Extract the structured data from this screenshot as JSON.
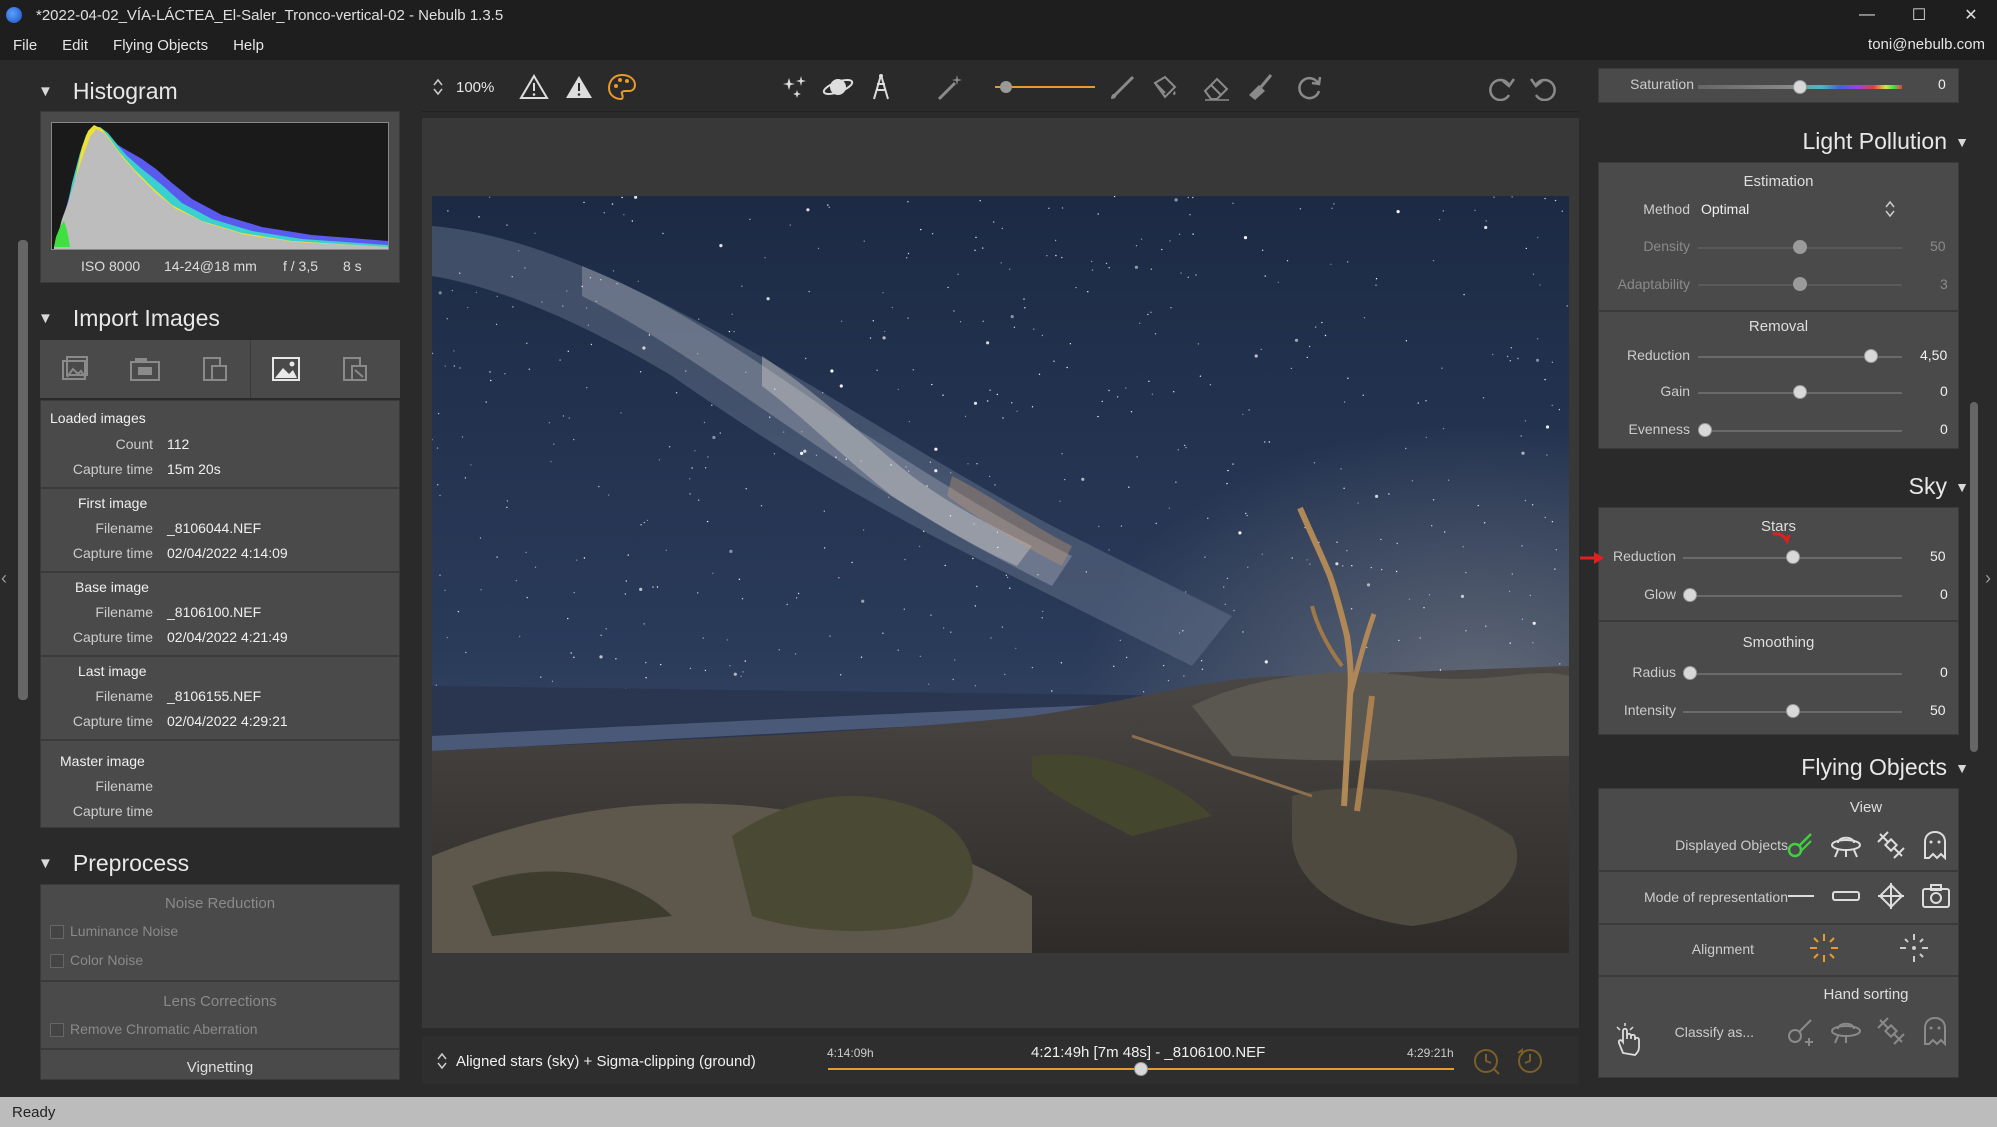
{
  "window": {
    "title": "*2022-04-02_VÍA-LÁCTEA_El-Saler_Tronco-vertical-02 - Nebulb 1.3.5",
    "minimize": "—",
    "maximize": "☐",
    "close": "✕"
  },
  "menu": {
    "items": [
      "File",
      "Edit",
      "Flying Objects",
      "Help"
    ],
    "user": "toni@nebulb.com"
  },
  "status": "Ready",
  "histogram": {
    "title": "Histogram",
    "iso": "ISO 8000",
    "lens": "14-24@18 mm",
    "aperture": "f / 3,5",
    "exposure": "8 s"
  },
  "import": {
    "title": "Import Images",
    "loaded_title": "Loaded images",
    "count_label": "Count",
    "count": "112",
    "capture_label": "Capture time",
    "capture_time": "15m 20s",
    "first_title": "First image",
    "filename_label": "Filename",
    "first_filename": "_8106044.NEF",
    "first_time": "02/04/2022 4:14:09",
    "base_title": "Base image",
    "base_filename": "_8106100.NEF",
    "base_time": "02/04/2022 4:21:49",
    "last_title": "Last image",
    "last_filename": "_8106155.NEF",
    "last_time": "02/04/2022 4:29:21",
    "master_title": "Master image"
  },
  "preprocess": {
    "title": "Preprocess",
    "noise_title": "Noise Reduction",
    "luminance": "Luminance Noise",
    "color": "Color Noise",
    "lens_title": "Lens Corrections",
    "chromatic": "Remove Chromatic Aberration",
    "vignetting": "Vignetting"
  },
  "toolbar": {
    "zoom": "100%"
  },
  "timeline": {
    "mode": "Aligned stars (sky) + Sigma-clipping (ground)",
    "start": "4:14:09h",
    "current": "4:21:49h [7m 48s] - _8106100.NEF",
    "end": "4:29:21h",
    "position": 0.5
  },
  "color_panel": {
    "saturation_label": "Saturation",
    "saturation": "0",
    "saturation_pos": 0.5
  },
  "light_pollution": {
    "title": "Light Pollution",
    "estimation": "Estimation",
    "method_label": "Method",
    "method": "Optimal",
    "density_label": "Density",
    "density": "50",
    "density_pos": 0.5,
    "adaptability_label": "Adaptability",
    "adaptability": "3",
    "adaptability_pos": 0.5,
    "removal": "Removal",
    "reduction_label": "Reduction",
    "reduction": "4,50",
    "reduction_pos": 0.875,
    "gain_label": "Gain",
    "gain": "0",
    "gain_pos": 0.5,
    "evenness_label": "Evenness",
    "evenness": "0",
    "evenness_pos": 0.0
  },
  "sky": {
    "title": "Sky",
    "stars": "Stars",
    "reduction_label": "Reduction",
    "reduction": "50",
    "reduction_pos": 0.5,
    "glow_label": "Glow",
    "glow": "0",
    "glow_pos": 0.0,
    "smoothing": "Smoothing",
    "radius_label": "Radius",
    "radius": "0",
    "radius_pos": 0.0,
    "intensity_label": "Intensity",
    "intensity": "50",
    "intensity_pos": 0.5
  },
  "flying": {
    "title": "Flying Objects",
    "view": "View",
    "displayed": "Displayed Objects",
    "mode": "Mode of representation",
    "alignment": "Alignment",
    "hand_sorting": "Hand sorting",
    "classify": "Classify as..."
  },
  "colors": {
    "accent": "#e89a2a",
    "panel": "#4a4a4a",
    "bg": "#2a2a2a"
  }
}
